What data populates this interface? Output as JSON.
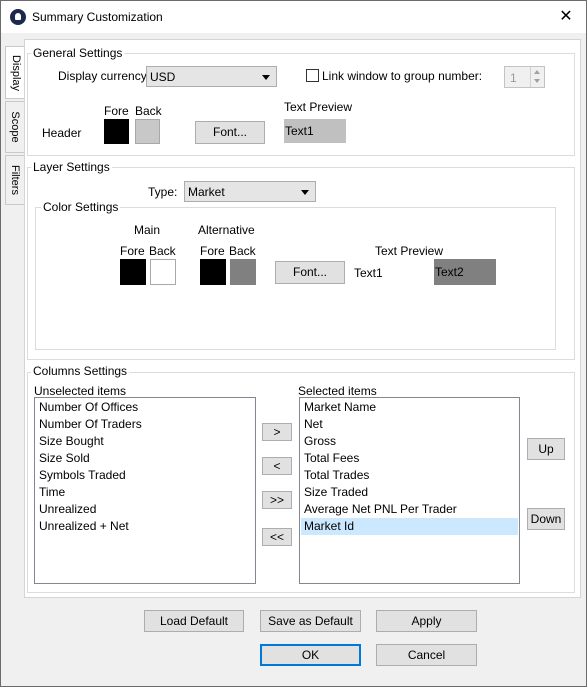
{
  "window": {
    "title": "Summary Customization",
    "close_glyph": "✕"
  },
  "tabs": [
    "Display",
    "Scope",
    "Filters"
  ],
  "general": {
    "label": "General Settings",
    "currency_label": "Display currency:",
    "currency_value": "USD",
    "link_label": "Link window to group number:",
    "link_checked": false,
    "group_number": "1",
    "fore_label": "Fore",
    "back_label": "Back",
    "header_label": "Header",
    "fore_color": "#000000",
    "back_color": "#c8c8c8",
    "font_button": "Font...",
    "preview_label": "Text Preview",
    "preview_text": "Text1",
    "preview_bg": "#c0c0c0"
  },
  "layer": {
    "label": "Layer Settings",
    "type_label": "Type:",
    "type_value": "Market",
    "color_settings_label": "Color Settings",
    "main_label": "Main",
    "alt_label": "Alternative",
    "fore_label": "Fore",
    "back_label": "Back",
    "main_fore": "#000000",
    "main_back": "#ffffff",
    "alt_fore": "#000000",
    "alt_back": "#808080",
    "font_button": "Font...",
    "preview_label": "Text Preview",
    "preview_text1": "Text1",
    "preview_text2": "Text2",
    "preview_text2_bg": "#808080"
  },
  "columns": {
    "label": "Columns Settings",
    "unselected_label": "Unselected items",
    "selected_label": "Selected items",
    "unselected": [
      "Number Of Offices",
      "Number Of Traders",
      "Size Bought",
      "Size Sold",
      "Symbols Traded",
      "Time",
      "Unrealized",
      "Unrealized + Net"
    ],
    "selected": [
      "Market Name",
      "Net",
      "Gross",
      "Total Fees",
      "Total Trades",
      "Size Traded",
      "Average Net PNL Per Trader",
      "Market Id"
    ],
    "selected_index": 7,
    "move_right": ">",
    "move_left": "<",
    "move_all_right": ">>",
    "move_all_left": "<<",
    "up": "Up",
    "down": "Down"
  },
  "footer": {
    "load_default": "Load Default",
    "save_default": "Save as Default",
    "apply": "Apply",
    "ok": "OK",
    "cancel": "Cancel"
  },
  "colors": {
    "selection": "#cce8ff",
    "default_button_border": "#0078d7"
  }
}
